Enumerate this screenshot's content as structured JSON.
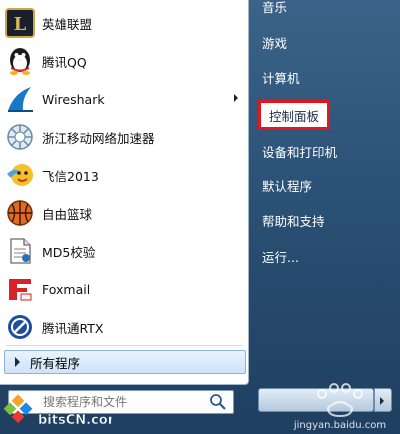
{
  "programs": [
    {
      "label": "英雄联盟",
      "icon": "league-of-legends-icon"
    },
    {
      "label": "腾讯QQ",
      "icon": "qq-penguin-icon"
    },
    {
      "label": "Wireshark",
      "icon": "wireshark-fin-icon",
      "has_submenu": true
    },
    {
      "label": "浙江移动网络加速器",
      "icon": "network-accelerator-icon"
    },
    {
      "label": "飞信2013",
      "icon": "fetion-icon"
    },
    {
      "label": "自由篮球",
      "icon": "basketball-icon"
    },
    {
      "label": "MD5校验",
      "icon": "md5-document-icon"
    },
    {
      "label": "Foxmail",
      "icon": "foxmail-icon"
    },
    {
      "label": "腾讯通RTX",
      "icon": "rtx-icon"
    }
  ],
  "all_programs_label": "所有程序",
  "search": {
    "placeholder": "搜索程序和文件"
  },
  "right_items": [
    {
      "label": "音乐"
    },
    {
      "label": "游戏"
    },
    {
      "label": "计算机"
    },
    {
      "label": "控制面板",
      "highlighted": true
    },
    {
      "label": "设备和打印机"
    },
    {
      "label": "默认程序"
    },
    {
      "label": "帮助和支持"
    },
    {
      "label": "运行..."
    }
  ],
  "watermarks": {
    "site_logo": "bitsCN.com",
    "jingyan": "jingyan.baidu.com"
  },
  "colors": {
    "highlight_border": "#e5161b",
    "pane_bg": "#ffffff",
    "right_pane_text": "#ffffff"
  }
}
